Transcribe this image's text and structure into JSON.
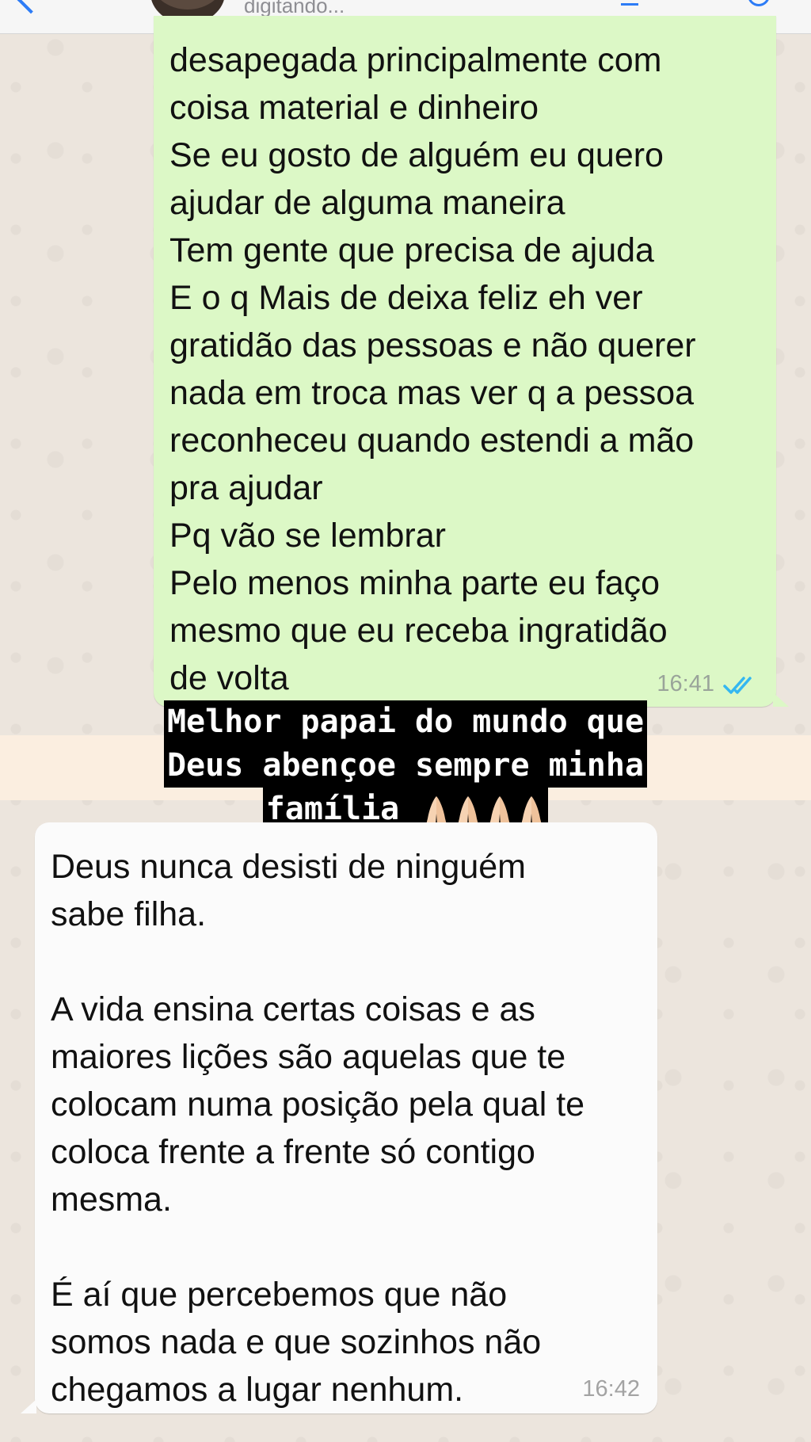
{
  "header": {
    "status": "digitando..."
  },
  "outgoing": {
    "lines": [
      "desapegada principalmente com",
      "coisa material e dinheiro",
      "Se eu gosto de alguém eu quero",
      "ajudar de alguma maneira",
      "Tem gente que precisa de ajuda",
      "E o q Mais de deixa feliz eh ver",
      "gratidão das pessoas e não querer",
      "nada em troca mas ver q a pessoa",
      "reconheceu quando estendi a mão",
      "pra ajudar",
      "Pq vão se lembrar",
      "Pelo menos minha parte eu faço",
      "mesmo que eu receba ingratidão",
      "de volta"
    ],
    "time": "16:41",
    "status_icon": "double-check-icon",
    "tick_color": "#34b7f1"
  },
  "story_overlay": {
    "lines": [
      "Melhor papai do mundo que",
      "Deus abençoe sempre minha",
      "família"
    ],
    "emoji_icon": "praying-hands-icon",
    "emoji_count": 4
  },
  "incoming": {
    "lines": [
      "Deus nunca desisti de ninguém",
      "sabe filha.",
      "",
      "A vida ensina certas coisas e as",
      "maiores lições são aquelas que te",
      "colocam numa posição pela qual te",
      "coloca frente a frente só contigo",
      "mesma.",
      "",
      "É aí que percebemos que não",
      "somos nada e que sozinhos não",
      "chegamos a lugar nenhum."
    ],
    "time": "16:42"
  },
  "colors": {
    "outgoing_bubble": "#dcf8c6",
    "incoming_bubble": "#fbfbfb",
    "wallpaper": "#ece5dd",
    "accent": "#2d7cf6"
  }
}
